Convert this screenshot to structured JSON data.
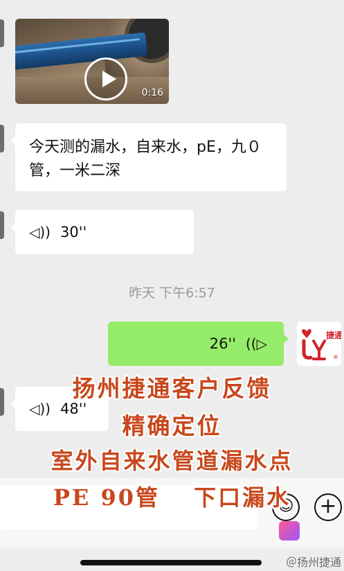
{
  "video_message": {
    "duration": "0:16"
  },
  "text_message": {
    "text": "今天测的漏水，自来水，pE，九０管，一米二深"
  },
  "voice_messages": {
    "first": {
      "length": "30''"
    },
    "mine": {
      "length": "26''"
    },
    "last": {
      "length": "48''"
    }
  },
  "time_separator": "昨天 下午6:57",
  "contact_avatar": {
    "brand": "捷通",
    "reg": "®"
  },
  "overlay": {
    "line1": "扬州捷通客户反馈",
    "line2": "精确定位",
    "line3": "室外自来水管道漏水点",
    "line4": "PE 90管　 下口漏水"
  },
  "watermark": {
    "text": "＠扬州捷通"
  },
  "colors": {
    "overlay_text": "#c8471c",
    "my_bubble": "#95ec69",
    "brand_red": "#d2232a"
  },
  "icons": {
    "play": "play-icon",
    "voice": "voice-wave-icon",
    "emoji": "emoji-icon",
    "plus": "plus-icon"
  }
}
